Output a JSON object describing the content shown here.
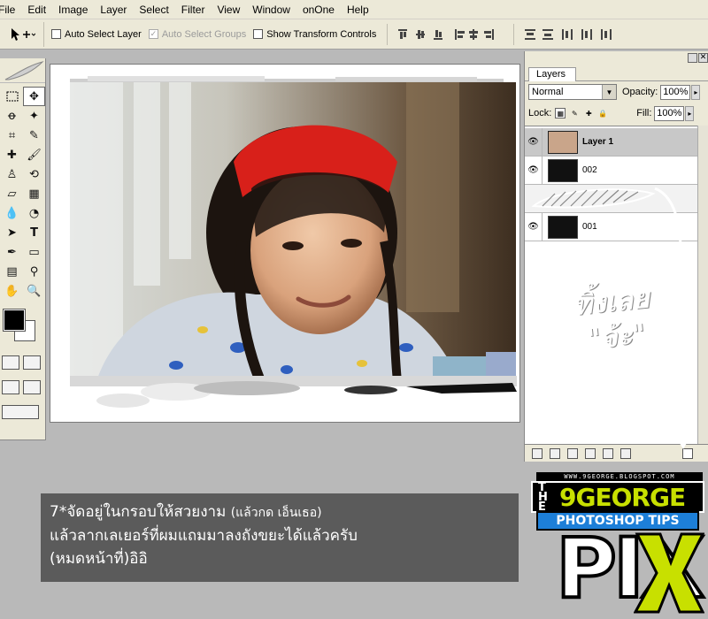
{
  "menu": [
    "File",
    "Edit",
    "Image",
    "Layer",
    "Select",
    "Filter",
    "View",
    "Window",
    "onOne",
    "Help"
  ],
  "options": {
    "auto_select_layer": "Auto Select Layer",
    "auto_select_groups": "Auto Select Groups",
    "show_transform_controls": "Show Transform Controls",
    "auto_select_groups_checked": true
  },
  "layers_panel": {
    "tab": "Layers",
    "blend_mode": "Normal",
    "opacity_label": "Opacity:",
    "opacity": "100%",
    "lock_label": "Lock:",
    "fill_label": "Fill:",
    "fill": "100%",
    "layers": [
      {
        "name": "Layer 1",
        "selected": true
      },
      {
        "name": "002",
        "selected": false
      },
      {
        "name": "",
        "selected": false
      },
      {
        "name": "001",
        "selected": false
      }
    ]
  },
  "handwriting": {
    "line1": "ทิ้งเลย",
    "line2": "\"จ้ะ\""
  },
  "caption": {
    "line1_main": "7*จัดอยู่ในกรอบให้สวยงาม",
    "line1_small": "(แล้วกด เอ็นเธอ)",
    "line2": "แล้วลากเลเยอร์ที่ผมแถมมาลงถังขยะได้แล้วครับ",
    "line3": "(หมดหน้าที่)อิอิ"
  },
  "logo": {
    "url_text": "WWW.9GEORGE.BLOGSPOT.COM",
    "the": "THE",
    "brand": "9GEORGE",
    "subtitle": "PHOTOSHOP TIPS",
    "pix": "PIX"
  },
  "colors": {
    "ui_bg": "#ece9d8",
    "workspace": "#b9b9b9",
    "caption_bg": "#5b5b5b",
    "logo_green": "#c8e000",
    "logo_blue": "#1d7fd8",
    "headband_red": "#d8201a"
  }
}
